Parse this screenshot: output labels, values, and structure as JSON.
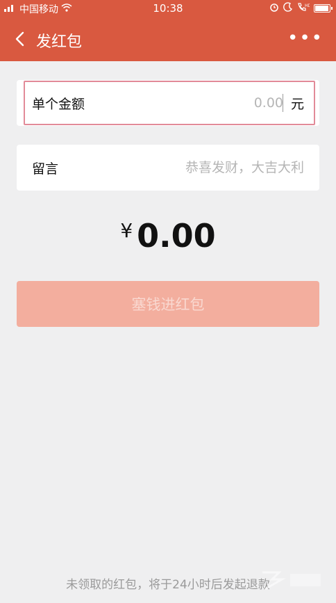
{
  "status": {
    "carrier": "中国移动",
    "time": "10:38"
  },
  "nav": {
    "title": "发红包",
    "more_label": "•••"
  },
  "amount": {
    "label": "单个金额",
    "placeholder": "0.00",
    "unit": "元"
  },
  "message": {
    "label": "留言",
    "placeholder": "恭喜发财，大吉大利"
  },
  "total": {
    "currency": "¥",
    "value": "0.00"
  },
  "submit": {
    "label": "塞钱进红包"
  },
  "footer": {
    "note": "未领取的红包，将于24小时后发起退款"
  },
  "colors": {
    "primary": "#d95940",
    "button_disabled": "#f3ae9e",
    "background": "#efeff0"
  }
}
